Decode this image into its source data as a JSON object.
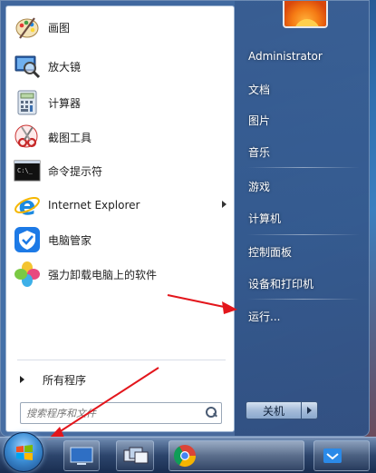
{
  "programs": [
    {
      "label": "画图",
      "icon": "paint-icon"
    },
    {
      "label": "放大镜",
      "icon": "magnifier-icon"
    },
    {
      "label": "计算器",
      "icon": "calculator-icon"
    },
    {
      "label": "截图工具",
      "icon": "scissors-icon"
    },
    {
      "label": "命令提示符",
      "icon": "cmd-icon"
    },
    {
      "label": "Internet Explorer",
      "icon": "ie-icon",
      "has_submenu": true
    },
    {
      "label": "电脑管家",
      "icon": "shield-icon"
    },
    {
      "label": "强力卸载电脑上的软件",
      "icon": "clover-icon"
    }
  ],
  "all_programs_label": "所有程序",
  "search": {
    "placeholder": "搜索程序和文件"
  },
  "right_items": [
    {
      "label": "Administrator"
    },
    {
      "label": "文档"
    },
    {
      "label": "图片"
    },
    {
      "label": "音乐"
    },
    {
      "label": "游戏"
    },
    {
      "label": "计算机"
    },
    {
      "label": "控制面板"
    },
    {
      "label": "设备和打印机"
    },
    {
      "label": "运行..."
    }
  ],
  "shutdown_label": "关机",
  "colors": {
    "menu_frame": "#466ea5",
    "ie_blue": "#1c8ae0",
    "annotation_red": "#e3161c"
  },
  "taskbar": {
    "buttons": [
      "desktop-icon",
      "window-switch-icon",
      "chrome-icon",
      "app-icon"
    ]
  }
}
